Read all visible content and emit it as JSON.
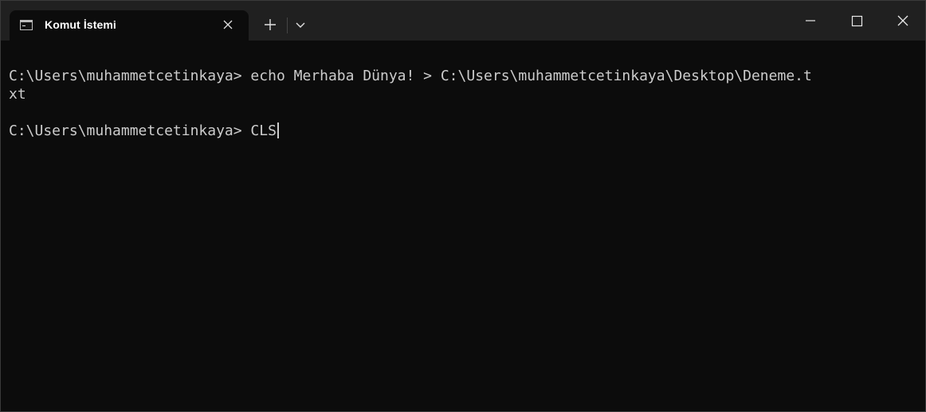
{
  "window": {
    "tab_title": "Komut İstemi",
    "tab_icon": "terminal-icon",
    "buttons": {
      "tab_close": "close-icon",
      "new_tab": "plus-icon",
      "dropdown": "chevron-down-icon",
      "minimize": "minimize-icon",
      "maximize": "maximize-icon",
      "close": "close-icon"
    },
    "colors": {
      "titlebar": "#202020",
      "background": "#0c0c0c",
      "text": "#cccccc"
    }
  },
  "terminal": {
    "lines": [
      "C:\\Users\\muhammetcetinkaya> echo Merhaba Dünya! > C:\\Users\\muhammetcetinkaya\\Desktop\\Deneme.t",
      "xt",
      "C:\\Users\\muhammetcetinkaya> CLS"
    ]
  }
}
